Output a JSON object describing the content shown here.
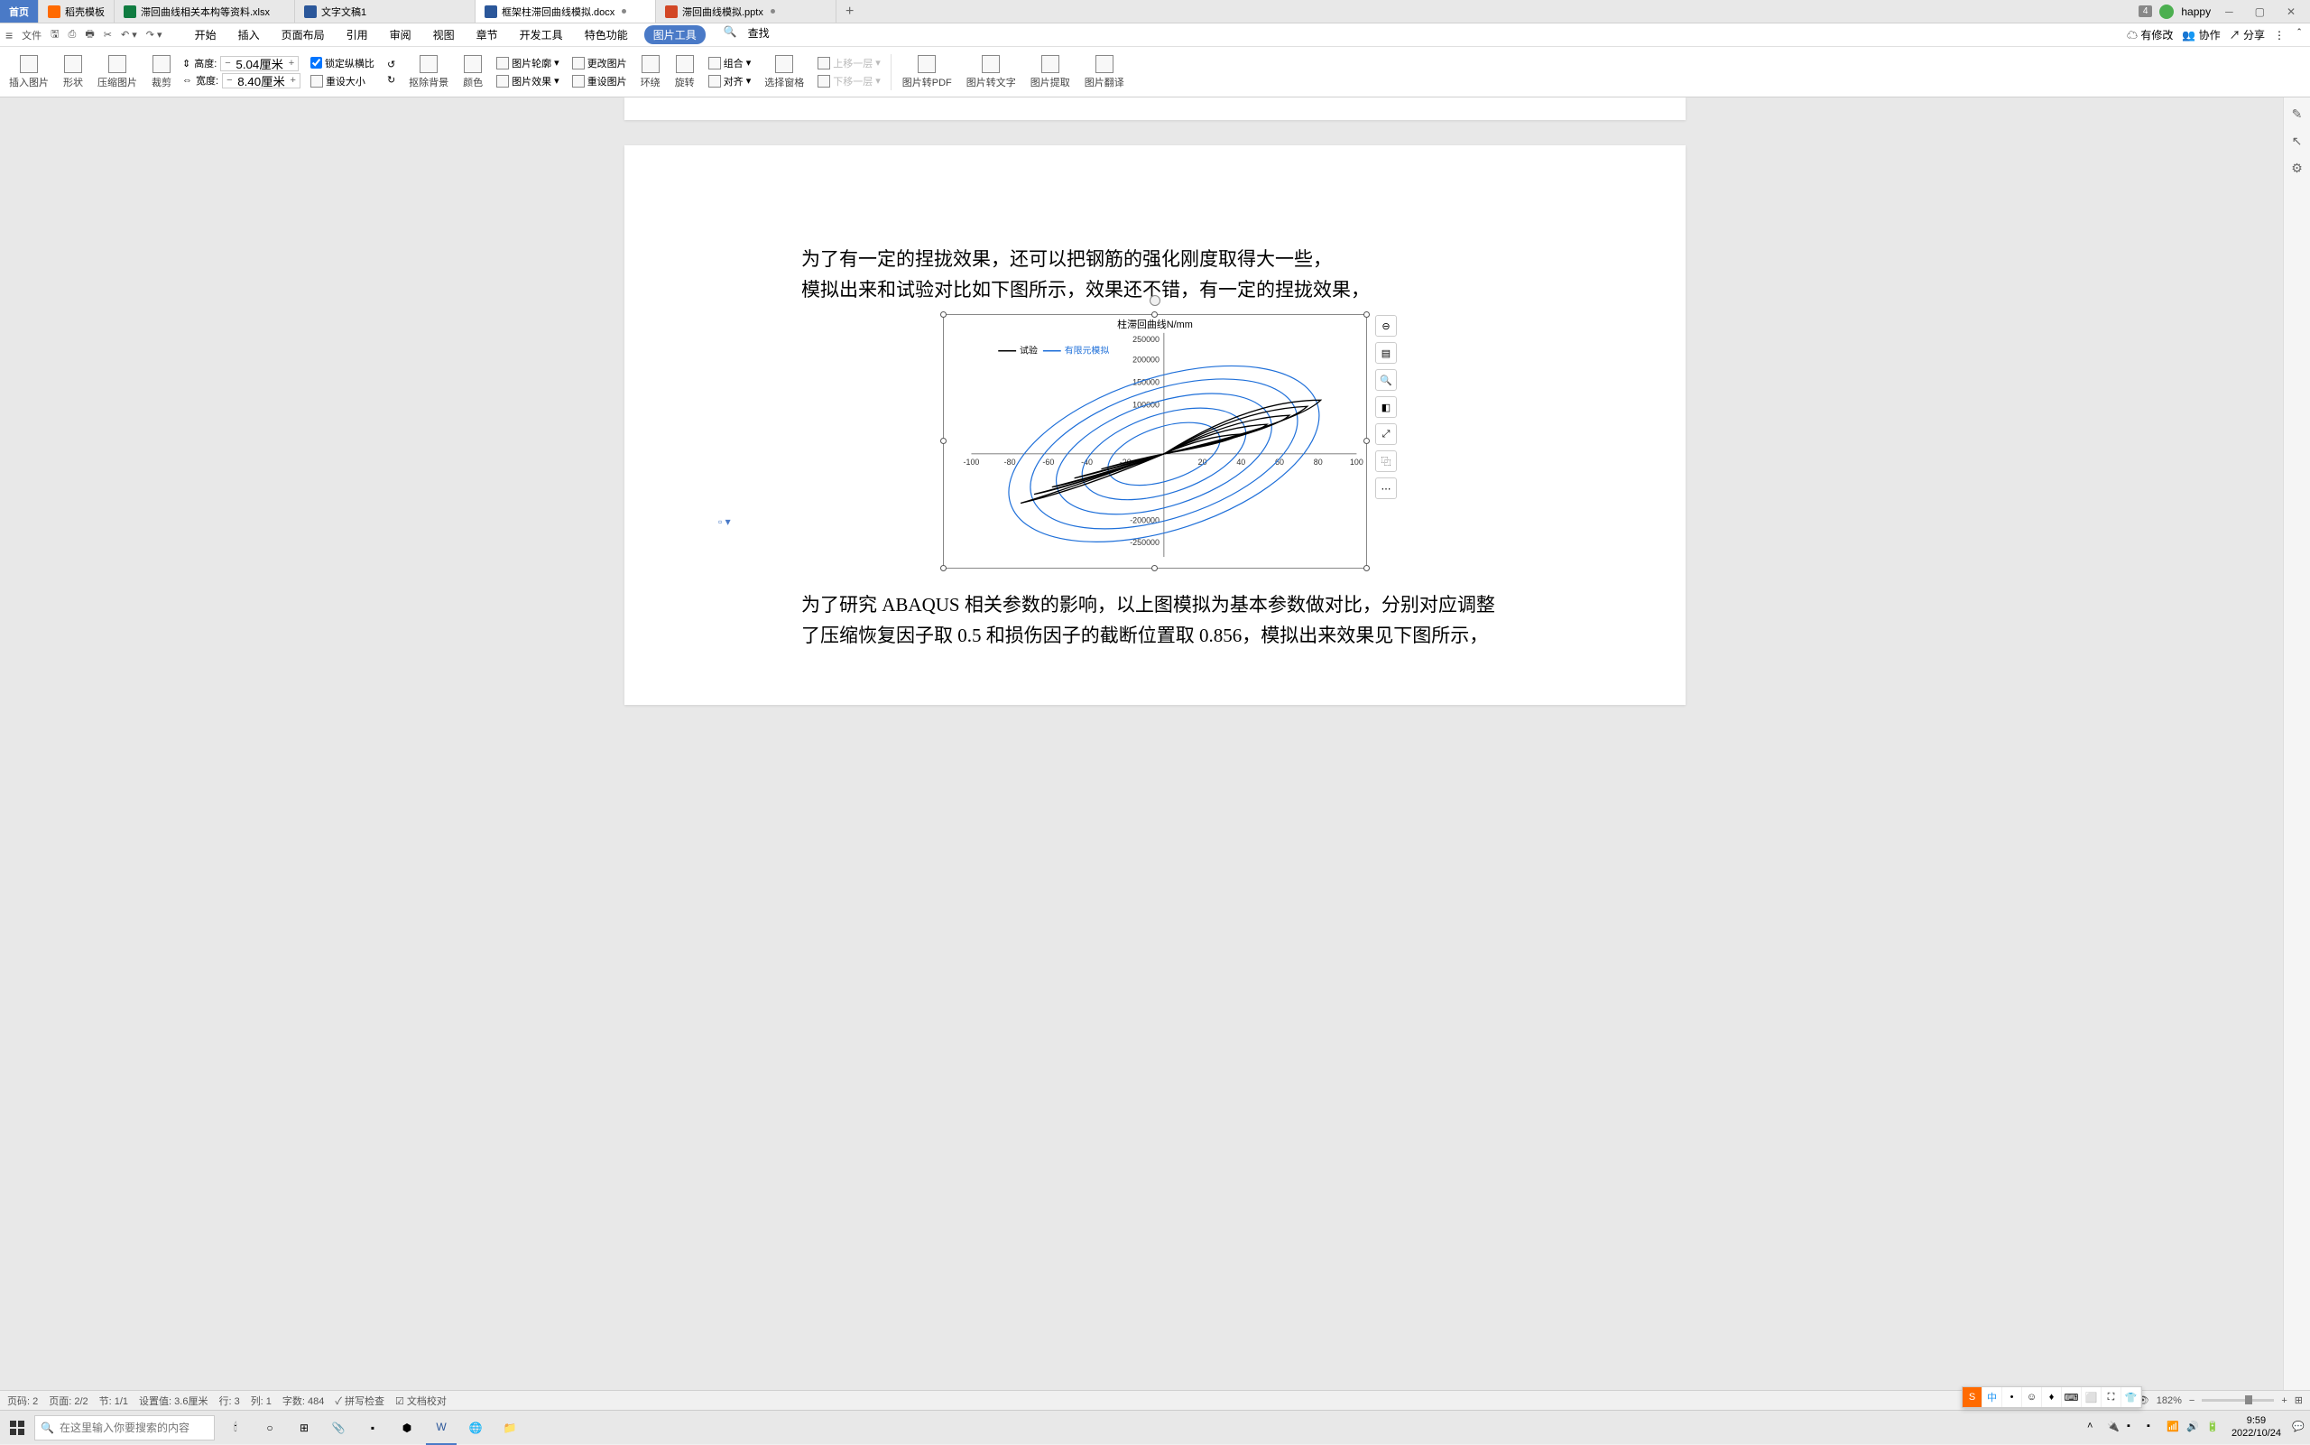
{
  "tabs": {
    "home": "首页",
    "list": [
      {
        "label": "稻壳模板",
        "color": "#ff6a00"
      },
      {
        "label": "滞回曲线相关本构等资料.xlsx",
        "color": "#107c41"
      },
      {
        "label": "文字文稿1",
        "color": "#2b579a"
      },
      {
        "label": "框架柱滞回曲线模拟.docx",
        "color": "#2b579a",
        "active": true,
        "dot": true
      },
      {
        "label": "滞回曲线模拟.pptx",
        "color": "#d24726",
        "dot": true
      }
    ],
    "badge": "4",
    "user": "happy"
  },
  "quickbar": {
    "file": "文件",
    "menus": [
      "开始",
      "插入",
      "页面布局",
      "引用",
      "审阅",
      "视图",
      "章节",
      "开发工具",
      "特色功能",
      "图片工具"
    ],
    "search": "查找",
    "right": {
      "modify": "有修改",
      "collab": "协作",
      "share": "分享"
    }
  },
  "ribbon": {
    "insert_pic": "插入图片",
    "shape": "形状",
    "compress": "压缩图片",
    "crop": "裁剪",
    "height_label": "高度:",
    "width_label": "宽度:",
    "height_val": "5.04厘米",
    "width_val": "8.40厘米",
    "lock_ratio": "锁定纵横比",
    "reset_size": "重设大小",
    "remove_bg": "抠除背景",
    "color": "颜色",
    "pic_outline": "图片轮廓",
    "change_pic": "更改图片",
    "pic_effect": "图片效果",
    "reset_pic": "重设图片",
    "wrap": "环绕",
    "rotate": "旋转",
    "align": "对齐",
    "combine": "组合",
    "select_pane": "选择窗格",
    "bring_fwd": "上移一层",
    "send_back": "下移一层",
    "to_pdf": "图片转PDF",
    "to_text": "图片转文字",
    "extract": "图片提取",
    "translate": "图片翻译"
  },
  "document": {
    "para1": "为了有一定的捏拢效果，还可以把钢筋的强化刚度取得大一些，\n模拟出来和试验对比如下图所示，效果还不错，有一定的捏拢效果，",
    "para2": "为了研究 ABAQUS 相关参数的影响，以上图模拟为基本参数做对比，分别对应调整了压缩恢复因子取 0.5 和损伤因子的截断位置取 0.856，模拟出来效果见下图所示，"
  },
  "chart_data": {
    "type": "line",
    "title": "柱滞回曲线N/mm",
    "legend": [
      "试验",
      "有限元模拟"
    ],
    "legend_colors": [
      "#000",
      "#1e6fd9"
    ],
    "xlim": [
      -100,
      100
    ],
    "ylim": [
      -250000,
      250000
    ],
    "xticks": [
      -100,
      -80,
      -60,
      -40,
      -20,
      0,
      20,
      40,
      60,
      80,
      100
    ],
    "yticks": [
      -250000,
      -200000,
      -150000,
      -100000,
      -50000,
      0,
      50000,
      100000,
      150000,
      200000,
      250000
    ],
    "ytick_labels_visible": [
      "250000",
      "200000",
      "150000",
      "100000",
      "",
      "",
      "",
      "",
      "",
      "-200000",
      "-250000"
    ],
    "series": [
      {
        "name": "试验",
        "color": "#000",
        "loops": "dense hysteresis loop family, peaks approx ±200000 N at ±80 mm"
      },
      {
        "name": "有限元模拟",
        "color": "#1e6fd9",
        "loops": "dense hysteresis loop family, peaks approx ±200000 N at ±80 mm, more open loops"
      }
    ]
  },
  "status": {
    "page": "页码: 2",
    "pages": "页面: 2/2",
    "sec": "节: 1/1",
    "pos": "设置值: 3.6厘米",
    "row": "行: 3",
    "col": "列: 1",
    "words": "字数: 484",
    "spell": "拼写检查",
    "proof": "文档校对",
    "zoom": "182%"
  },
  "taskbar": {
    "search_ph": "在这里输入你要搜索的内容"
  },
  "clock": {
    "time": "9:59",
    "date": "2022/10/24"
  },
  "ime": [
    "中",
    "•",
    "☺",
    "♦",
    "⌨",
    "⬜",
    "⛶",
    "👕"
  ]
}
